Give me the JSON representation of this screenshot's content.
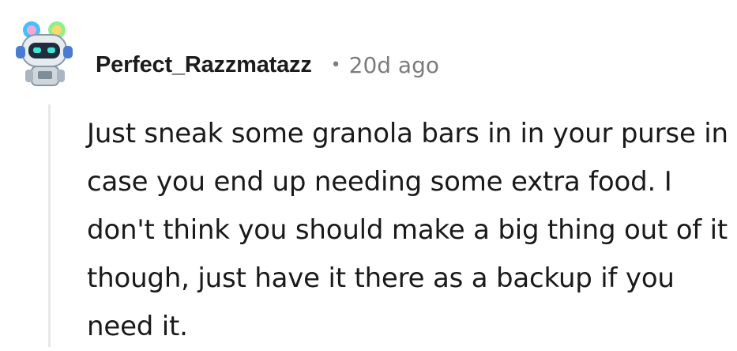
{
  "comment": {
    "username": "Perfect_Razzmatazz",
    "separator": "•",
    "timestamp": "20d ago",
    "body": "Just sneak some granola bars in in your purse in case you end up needing some extra food. I don't think you should make a big thing out of it though, just have it there as a backup if you need it."
  },
  "avatar": {
    "icon": "robot-snoo-avatar-icon",
    "colors": {
      "body": "#cfd6dc",
      "visor": "#1f2d3d",
      "eyes": "#3ee8d4",
      "goggle_left": "#43c0ff",
      "goggle_right": "#8ef08c"
    }
  },
  "colors": {
    "username": "#1c1c1c",
    "meta": "#7c7c7c",
    "text": "#1a1a1b",
    "thread_line": "#e8e8e8"
  }
}
